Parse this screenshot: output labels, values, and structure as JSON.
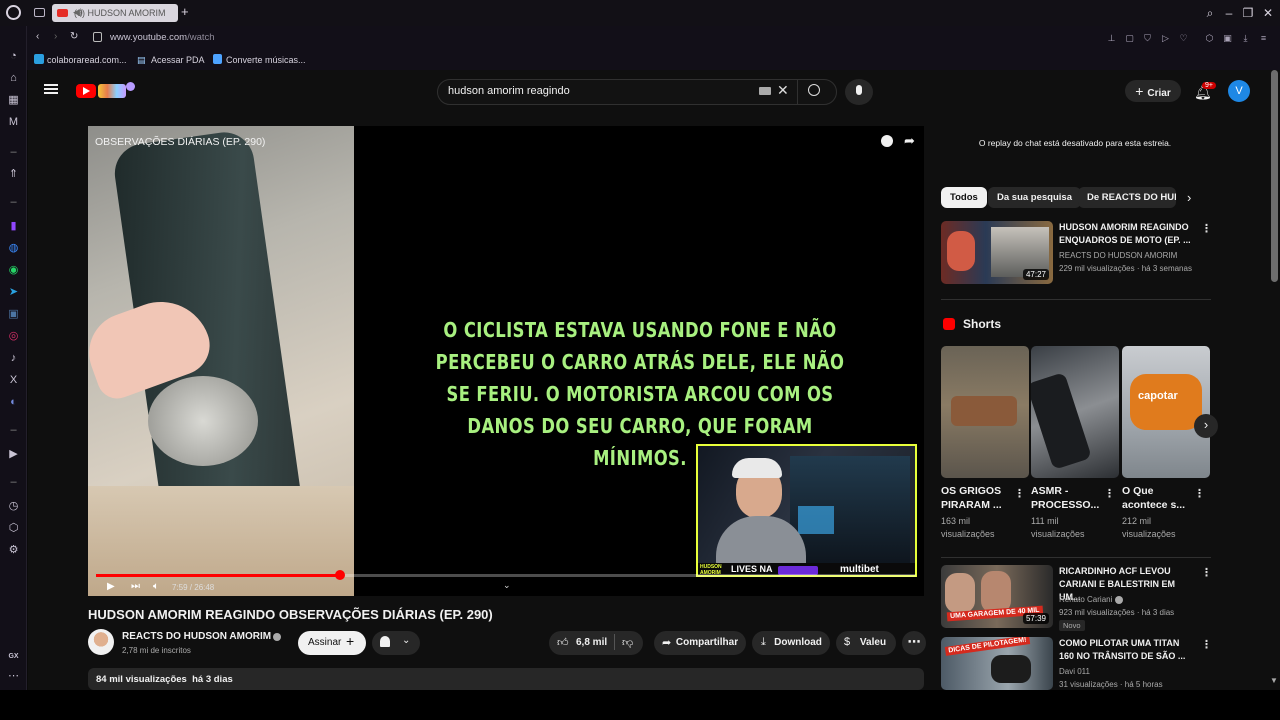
{
  "browser": {
    "tab_title": "(9) HUDSON AMORIM",
    "url_domain": "www.youtube.com",
    "url_path": "/watch",
    "bookmarks": [
      "colaboraread.com...",
      "Acessar PDA",
      "Converte músicas..."
    ],
    "gx_label": "GX"
  },
  "youtube": {
    "search_query": "hudson amorim reagindo",
    "create_label": "Criar",
    "notif_badge": "9+",
    "avatar_letter": "V"
  },
  "video": {
    "overlay_title": "OBSERVAÇÕES DIÁRIAS (EP. 290)",
    "caption": "O CICLISTA ESTAVA USANDO FONE E NÃO PERCEBEU O CARRO ATRÁS DELE, ELE NÃO SE FERIU. O MOTORISTA ARCOU COM OS DANOS DO SEU CARRO, QUE FORAM MÍNIMOS.",
    "time": "7:59 / 26:48",
    "progress": 0.298,
    "cam_brand_left": "HUDSON AMORIM",
    "cam_label": "LIVES NA",
    "cam_sponsor": "multibet",
    "title": "HUDSON AMORIM REAGINDO OBSERVAÇÕES DIÁRIAS (EP. 290)",
    "channel": "REACTS DO HUDSON AMORIM",
    "subscribers": "2,78 mi de inscritos",
    "subscribe_label": "Assinar",
    "likes": "6,8 mil",
    "share_label": "Compartilhar",
    "download_label": "Download",
    "thanks_label": "Valeu",
    "views_date": "84 mil visualizações  há 3 dias"
  },
  "sidebar": {
    "chat_notice": "O replay do chat está desativado para esta estreia.",
    "chips": [
      "Todos",
      "Da sua pesquisa",
      "De REACTS DO HUDSO"
    ],
    "top_video": {
      "title": "HUDSON AMORIM REAGINDO ENQUADROS DE MOTO (EP. ...",
      "channel": "REACTS DO HUDSON AMORIM",
      "meta": "229 mil visualizações · há 3 semanas",
      "duration": "47:27"
    },
    "shorts_heading": "Shorts",
    "shorts": [
      {
        "title": "OS GRIGOS PIRARAM ...",
        "views": "163 mil visualizações"
      },
      {
        "title": "ASMR - PROCESSO...",
        "views": "111 mil visualizações"
      },
      {
        "title": "O Que acontece s...",
        "views": "212 mil visualizações",
        "overlay": "capotar"
      }
    ],
    "videos": [
      {
        "title": "RICARDINHO ACF LEVOU CARIANI E BALESTRIN EM UM...",
        "channel": "Renato Cariani",
        "meta": "923 mil visualizações · há 3 dias",
        "badge": "Novo",
        "duration": "57:39",
        "thumb_text": "UMA GARAGEM DE 40 MIL"
      },
      {
        "title": "COMO PILOTAR UMA TITAN 160 NO TRÂNSITO DE SÃO ...",
        "channel": "Davi 011",
        "meta": "31 visualizações · há 5 horas",
        "thumb_text": "DICAS DE PILOTAGEM!"
      }
    ]
  },
  "colors": {
    "accent_red": "#ff0000",
    "caption_green": "#a8f080",
    "cam_border": "#e8ff3a"
  }
}
